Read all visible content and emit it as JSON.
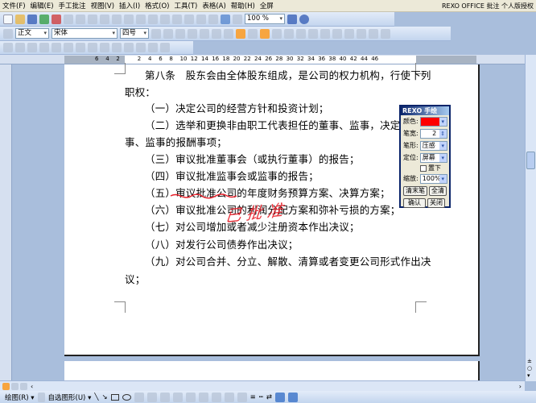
{
  "menu": {
    "items": [
      "文件(F)",
      "编辑(E)",
      "手工批注",
      "视图(V)",
      "插入(I)",
      "格式(O)",
      "工具(T)",
      "表格(A)",
      "帮助(H)",
      "全屏"
    ],
    "app_title": "REXO OFFICE 批注 个人版授权"
  },
  "toolbar": {
    "zoom": "100 %",
    "style": "正文",
    "font": "宋体",
    "size": "四号"
  },
  "ruler": {
    "ticks": [
      "6",
      "4",
      "2",
      "",
      "2",
      "4",
      "6",
      "8",
      "10",
      "12",
      "14",
      "16",
      "18",
      "20",
      "22",
      "24",
      "26",
      "28",
      "30",
      "32",
      "34",
      "36",
      "38",
      "40",
      "42",
      "44",
      "46"
    ]
  },
  "document": {
    "lines": [
      "第八条　股东会由全体股东组成，是公司的权力机构，行使下列",
      "职权：",
      "（一）决定公司的经营方针和投资计划；",
      "（二）选举和更换非由职工代表担任的董事、监事，决定有关",
      "事、监事的报酬事项；",
      "（三）审议批准董事会（或执行董事）的报告；",
      "（四）审议批准监事会或监事的报告；",
      "（五）审议批准公司的年度财务预算方案、决算方案；",
      "（六）审议批准公司的利润分配方案和弥补亏损的方案；",
      "（七）对公司增加或者减少注册资本作出决议；",
      "（八）对发行公司债券作出决议；",
      "（九）对公司合并、分立、解散、清算或者变更公司形式作出决",
      "议；"
    ]
  },
  "annotation": {
    "handwriting": "已批准",
    "color": "#e8202a"
  },
  "panel": {
    "title": "REXO 手绘工...",
    "color_label": "颜色:",
    "color_value": "#ff0000",
    "width_label": "笔宽:",
    "width_value": "2",
    "shape_label": "笔形:",
    "shape_value": "压感",
    "pos_label": "定位:",
    "pos_value": "屏幕",
    "below_label": "置下",
    "below_checked": false,
    "zoom_label": "缩放:",
    "zoom_value": "100%",
    "clear_last": "清末笔",
    "clear_all": "全清",
    "ok": "确认",
    "close": "关闭"
  },
  "drawbar": {
    "draw": "绘图(R) ▾",
    "autoshape": "自选图形(U) ▾"
  }
}
